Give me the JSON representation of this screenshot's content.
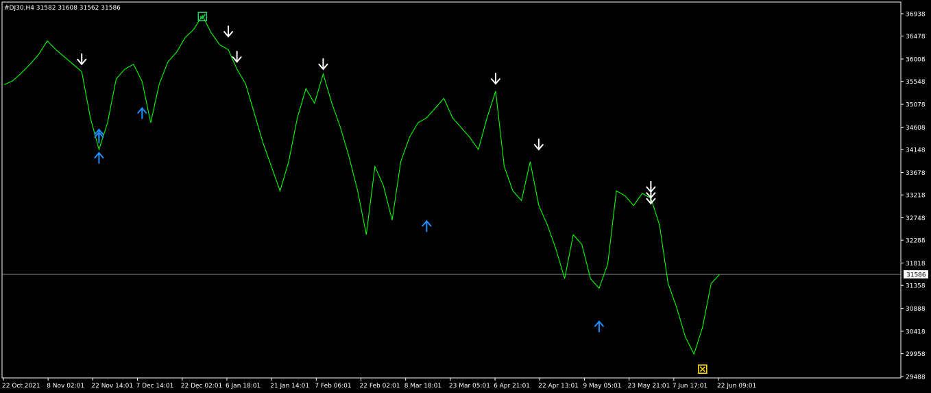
{
  "window": {
    "header": "#DJ30,H4  31582 31608 31562 31586"
  },
  "colors": {
    "background": "#000000",
    "price_line": "#00ff00",
    "axis": "#ffffff",
    "sell_arrow": "#ffffff",
    "buy_arrow": "#1e90ff",
    "win_marker": "#2ecc71",
    "loss_marker": "#ffd700"
  },
  "chart_data": {
    "type": "line",
    "symbol": "#DJ30",
    "timeframe": "H4",
    "ohlc": {
      "open": 31582,
      "high": 31608,
      "low": 31562,
      "close": 31586
    },
    "current_price": 31586,
    "current_price_label": "31586",
    "ylim": [
      29488,
      37030
    ],
    "y_ticks": [
      36938,
      36478,
      36008,
      35548,
      35078,
      34608,
      34148,
      33678,
      33218,
      32748,
      32288,
      31818,
      31358,
      30888,
      30418,
      29958,
      29488
    ],
    "x_ticks": [
      "22 Oct 2021",
      "8 Nov 02:01",
      "22 Nov 14:01",
      "7 Dec 14:01",
      "22 Dec 02:01",
      "6 Jan 18:01",
      "21 Jan 14:01",
      "7 Feb 06:01",
      "22 Feb 02:01",
      "8 Mar 18:01",
      "23 Mar 05:01",
      "6 Apr 21:01",
      "22 Apr 13:01",
      "9 May 05:01",
      "23 May 21:01",
      "7 Jun 17:01",
      "22 Jun 09:01"
    ],
    "x": [
      "22 Oct 2021",
      "25 Oct",
      "28 Oct",
      "1 Nov",
      "4 Nov",
      "8 Nov",
      "11 Nov",
      "15 Nov",
      "18 Nov",
      "22 Nov",
      "24 Nov",
      "26 Nov",
      "29 Nov",
      "1 Dec",
      "3 Dec",
      "7 Dec",
      "9 Dec",
      "13 Dec",
      "15 Dec",
      "17 Dec",
      "20 Dec",
      "22 Dec",
      "27 Dec",
      "29 Dec",
      "31 Dec",
      "4 Jan",
      "6 Jan",
      "10 Jan",
      "12 Jan",
      "14 Jan",
      "18 Jan",
      "21 Jan",
      "24 Jan",
      "26 Jan",
      "28 Jan",
      "1 Feb",
      "4 Feb",
      "7 Feb",
      "10 Feb",
      "14 Feb",
      "17 Feb",
      "22 Feb",
      "24 Feb",
      "28 Feb",
      "3 Mar",
      "8 Mar",
      "10 Mar",
      "14 Mar",
      "16 Mar",
      "18 Mar",
      "21 Mar",
      "23 Mar",
      "25 Mar",
      "29 Mar",
      "31 Mar",
      "4 Apr",
      "6 Apr",
      "8 Apr",
      "12 Apr",
      "14 Apr",
      "19 Apr",
      "22 Apr",
      "26 Apr",
      "29 Apr",
      "3 May",
      "6 May",
      "9 May",
      "11 May",
      "13 May",
      "17 May",
      "19 May",
      "23 May",
      "25 May",
      "27 May",
      "1 Jun",
      "3 Jun",
      "7 Jun",
      "9 Jun",
      "13 Jun",
      "15 Jun",
      "17 Jun",
      "22 Jun",
      "24 Jun",
      "27 Jun"
    ],
    "values": [
      35480,
      35560,
      35720,
      35900,
      36100,
      36380,
      36200,
      36050,
      35900,
      35750,
      34800,
      34150,
      34700,
      35600,
      35800,
      35900,
      35550,
      34700,
      35500,
      35950,
      36150,
      36450,
      36620,
      36900,
      36550,
      36300,
      36200,
      35800,
      35500,
      34900,
      34300,
      33800,
      33300,
      33900,
      34800,
      35400,
      35100,
      35700,
      35100,
      34600,
      34000,
      33300,
      32400,
      33800,
      33400,
      32700,
      33900,
      34400,
      34700,
      34800,
      35000,
      35200,
      34800,
      34600,
      34400,
      34150,
      34800,
      35350,
      33800,
      33300,
      33100,
      33900,
      33000,
      32600,
      32100,
      31500,
      32400,
      32200,
      31500,
      31300,
      31800,
      33300,
      33200,
      33000,
      33250,
      33150,
      32600,
      31400,
      30900,
      30300,
      29950,
      30500,
      31400,
      31590
    ],
    "sell_signals": [
      {
        "x": "22 Nov",
        "price": 35900
      },
      {
        "x": "6 Jan",
        "price": 36470
      },
      {
        "x": "10 Jan",
        "price": 35950
      },
      {
        "x": "7 Feb",
        "price": 35800
      },
      {
        "x": "8 Apr",
        "price": 35500
      },
      {
        "x": "26 Apr",
        "price": 34150
      },
      {
        "x": "3 Jun",
        "price": 33280
      },
      {
        "x": "3 Jun",
        "price": 33160
      },
      {
        "x": "3 Jun",
        "price": 33040
      }
    ],
    "buy_signals": [
      {
        "x": "26 Nov",
        "price": 34080
      },
      {
        "x": "26 Nov",
        "price": 34500
      },
      {
        "x": "26 Nov",
        "price": 34560
      },
      {
        "x": "9 Dec",
        "price": 35000
      },
      {
        "x": "18 Mar",
        "price": 32680
      },
      {
        "x": "17 May",
        "price": 30620
      }
    ],
    "trade_markers": [
      {
        "kind": "win",
        "x": "29 Dec",
        "price": 36880
      },
      {
        "kind": "loss",
        "x": "22 Jun",
        "price": 29640
      }
    ]
  }
}
